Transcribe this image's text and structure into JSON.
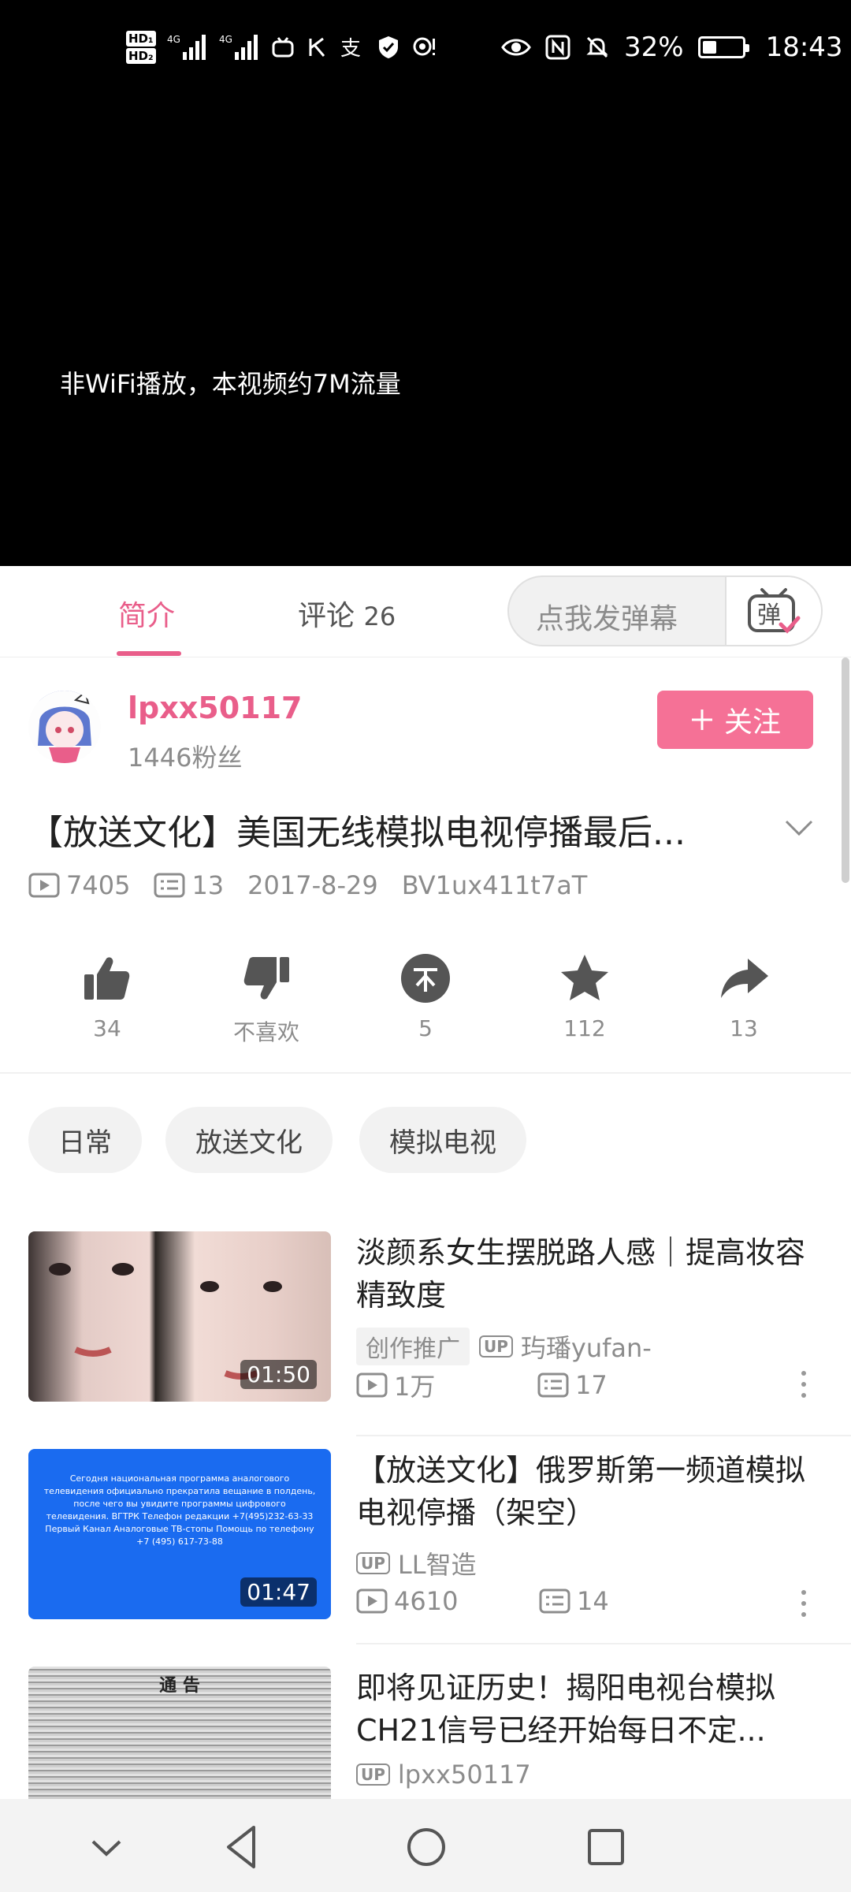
{
  "status_bar": {
    "battery_percent": "32%",
    "time": "18:43"
  },
  "video": {
    "non_wifi_notice": "非WiFi播放，本视频约7M流量"
  },
  "tabs": {
    "intro": "简介",
    "comments_label": "评论",
    "comments_count": "26",
    "danmaku_placeholder": "点我发弹幕",
    "danmaku_toggle_glyph": "弹"
  },
  "author": {
    "name": "lpxx50117",
    "fans": "1446粉丝",
    "follow_label": "关注"
  },
  "video_info": {
    "title": "【放送文化】美国无线模拟电视停播最后...",
    "views": "7405",
    "danmaku_count": "13",
    "date": "2017-8-29",
    "bvid": "BV1ux411t7aT"
  },
  "actions": [
    {
      "name": "like",
      "label": "34"
    },
    {
      "name": "dislike",
      "label": "不喜欢"
    },
    {
      "name": "coin",
      "label": "5"
    },
    {
      "name": "favorite",
      "label": "112"
    },
    {
      "name": "share",
      "label": "13"
    }
  ],
  "tags": [
    "日常",
    "放送文化",
    "模拟电视"
  ],
  "related": [
    {
      "title": "淡颜系女生摆脱路人感｜提高妆容精致度",
      "duration": "01:50",
      "badge": "创作推广",
      "up_tag": "UP",
      "uploader": "玙璠yufan-",
      "views": "1万",
      "danmaku": "17"
    },
    {
      "title": "【放送文化】俄罗斯第一频道模拟电视停播（架空）",
      "duration": "01:47",
      "up_tag": "UP",
      "uploader": "LL智造",
      "views": "4610",
      "danmaku": "14",
      "thumb_text": "Сегодня национальная программа аналогового телевидения официально прекратила вещание в полдень, после чего вы увидите программы цифрового телевидения. ВГТРК Телефон редакции +7(495)232-63-33 Первый Канал Аналоговые ТВ-стопы Помощь по телефону +7 (495) 617-73-88"
    },
    {
      "title": "即将见证历史！揭阳电视台模拟CH21信号已经开始每日不定...",
      "up_tag": "UP",
      "uploader": "lpxx50117",
      "thumb_text": "通 告"
    }
  ],
  "colors": {
    "accent": "#e95e8a",
    "follow_button": "#f57196",
    "thumb_blue": "#1a6bf0"
  }
}
